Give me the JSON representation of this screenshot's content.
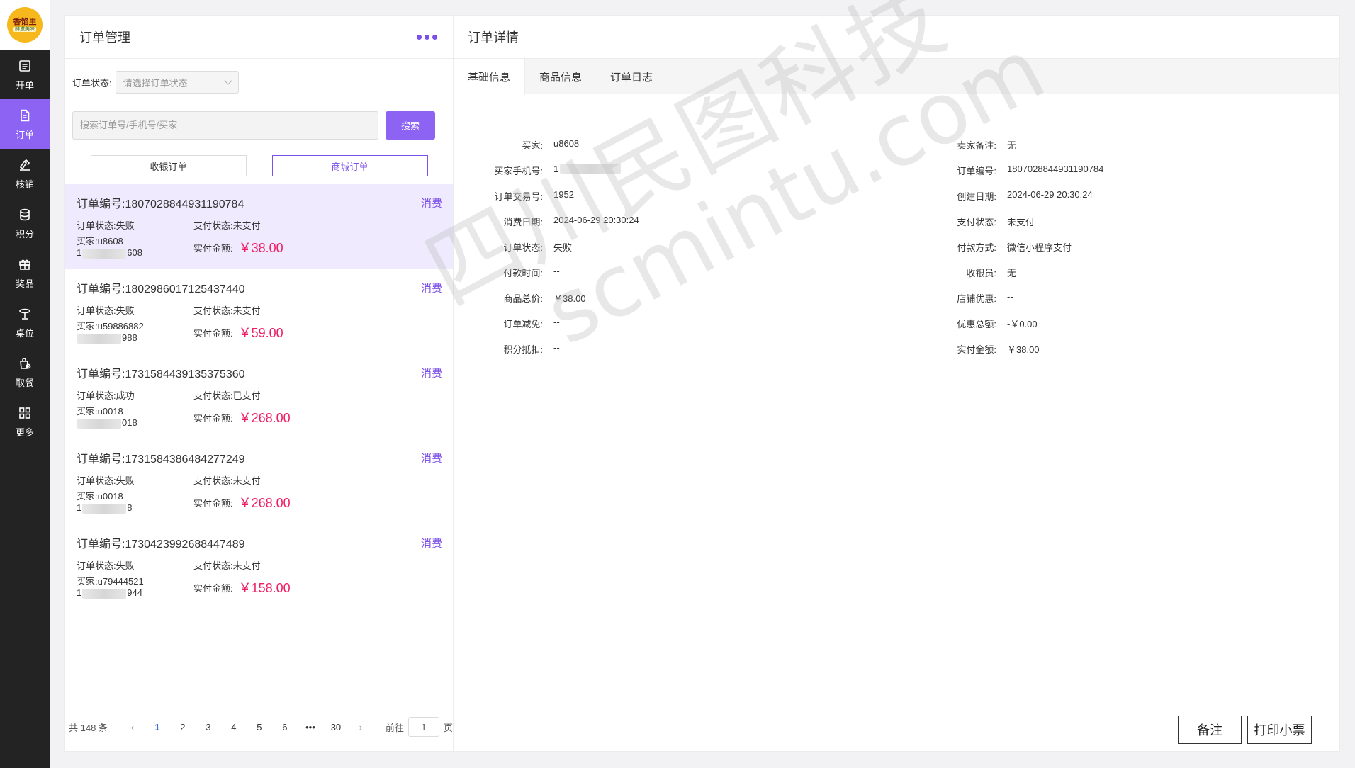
{
  "brand": {
    "logo_line1": "香馅里",
    "logo_line2": "鲜滋美味"
  },
  "sidebar": {
    "items": [
      {
        "label": "开单",
        "icon": "order-open-icon"
      },
      {
        "label": "订单",
        "icon": "order-doc-icon"
      },
      {
        "label": "核销",
        "icon": "verify-icon"
      },
      {
        "label": "积分",
        "icon": "points-icon"
      },
      {
        "label": "奖品",
        "icon": "gift-icon"
      },
      {
        "label": "桌位",
        "icon": "table-icon"
      },
      {
        "label": "取餐",
        "icon": "pickup-icon"
      },
      {
        "label": "更多",
        "icon": "more-grid-icon"
      }
    ],
    "active_index": 1
  },
  "left_panel": {
    "title": "订单管理",
    "filter_label": "订单状态:",
    "filter_placeholder": "请选择订单状态",
    "search_placeholder": "搜索订单号/手机号/买家",
    "search_button": "搜索",
    "order_types": [
      "收银订单",
      "商城订单"
    ],
    "active_type_index": 1,
    "orders": [
      {
        "no_label": "订单编号:",
        "no": "1807028844931190784",
        "tag": "消费",
        "status_label": "订单状态:",
        "status": "失败",
        "pay_status_label": "支付状态:",
        "pay_status": "未支付",
        "buyer_label": "买家:",
        "buyer": "u8608",
        "phone_head": "1",
        "phone_tail": "608",
        "amount_label": "实付金额:",
        "amount": "￥38.00"
      },
      {
        "no_label": "订单编号:",
        "no": "1802986017125437440",
        "tag": "消费",
        "status_label": "订单状态:",
        "status": "失败",
        "pay_status_label": "支付状态:",
        "pay_status": "未支付",
        "buyer_label": "买家:",
        "buyer": "u59886882",
        "phone_head": "",
        "phone_tail": "988",
        "amount_label": "实付金额:",
        "amount": "￥59.00"
      },
      {
        "no_label": "订单编号:",
        "no": "1731584439135375360",
        "tag": "消费",
        "status_label": "订单状态:",
        "status": "成功",
        "pay_status_label": "支付状态:",
        "pay_status": "已支付",
        "buyer_label": "买家:",
        "buyer": "u0018",
        "phone_head": "",
        "phone_tail": "018",
        "amount_label": "实付金额:",
        "amount": "￥268.00"
      },
      {
        "no_label": "订单编号:",
        "no": "1731584386484277249",
        "tag": "消费",
        "status_label": "订单状态:",
        "status": "失败",
        "pay_status_label": "支付状态:",
        "pay_status": "未支付",
        "buyer_label": "买家:",
        "buyer": "u0018",
        "phone_head": "1",
        "phone_tail": "8",
        "amount_label": "实付金额:",
        "amount": "￥268.00"
      },
      {
        "no_label": "订单编号:",
        "no": "1730423992688447489",
        "tag": "消费",
        "status_label": "订单状态:",
        "status": "失败",
        "pay_status_label": "支付状态:",
        "pay_status": "未支付",
        "buyer_label": "买家:",
        "buyer": "u79444521",
        "phone_head": "1",
        "phone_tail": "944",
        "amount_label": "实付金额:",
        "amount": "￥158.00"
      }
    ],
    "selected_index": 0,
    "pagination": {
      "total_text": "共 148 条",
      "pages": [
        "1",
        "2",
        "3",
        "4",
        "5",
        "6",
        "•••",
        "30"
      ],
      "current": "1",
      "goto_prefix": "前往",
      "goto_value": "1",
      "goto_suffix": "页"
    }
  },
  "right_panel": {
    "title": "订单详情",
    "tabs": [
      "基础信息",
      "商品信息",
      "订单日志"
    ],
    "active_tab_index": 0,
    "left_fields": [
      {
        "label": "买家:",
        "value": "u8608"
      },
      {
        "label": "买家手机号:",
        "value": "1"
      },
      {
        "label": "订单交易号:",
        "value": "1952"
      },
      {
        "label": "消费日期:",
        "value": "2024-06-29 20:30:24"
      },
      {
        "label": "订单状态:",
        "value": "失败"
      },
      {
        "label": "付款时间:",
        "value": "--"
      },
      {
        "label": "商品总价:",
        "value": "￥38.00"
      },
      {
        "label": "订单减免:",
        "value": "--"
      },
      {
        "label": "积分抵扣:",
        "value": "--"
      }
    ],
    "right_fields": [
      {
        "label": "卖家备注:",
        "value": "无"
      },
      {
        "label": "订单编号:",
        "value": "1807028844931190784"
      },
      {
        "label": "创建日期:",
        "value": "2024-06-29 20:30:24"
      },
      {
        "label": "支付状态:",
        "value": "未支付"
      },
      {
        "label": "付款方式:",
        "value": "微信小程序支付"
      },
      {
        "label": "收银员:",
        "value": "无"
      },
      {
        "label": "店铺优惠:",
        "value": "--"
      },
      {
        "label": "优惠总额:",
        "value": "-￥0.00"
      },
      {
        "label": "实付金额:",
        "value": "￥38.00"
      }
    ],
    "buttons": {
      "remark": "备注",
      "print": "打印小票"
    }
  },
  "watermark": {
    "line1": "四川民图科技",
    "line2": "scmintu.com"
  },
  "colors": {
    "accent": "#8c63f2",
    "sidebar_bg": "#232323",
    "amount": "#ee1e63",
    "selected_row": "#efeafd"
  }
}
